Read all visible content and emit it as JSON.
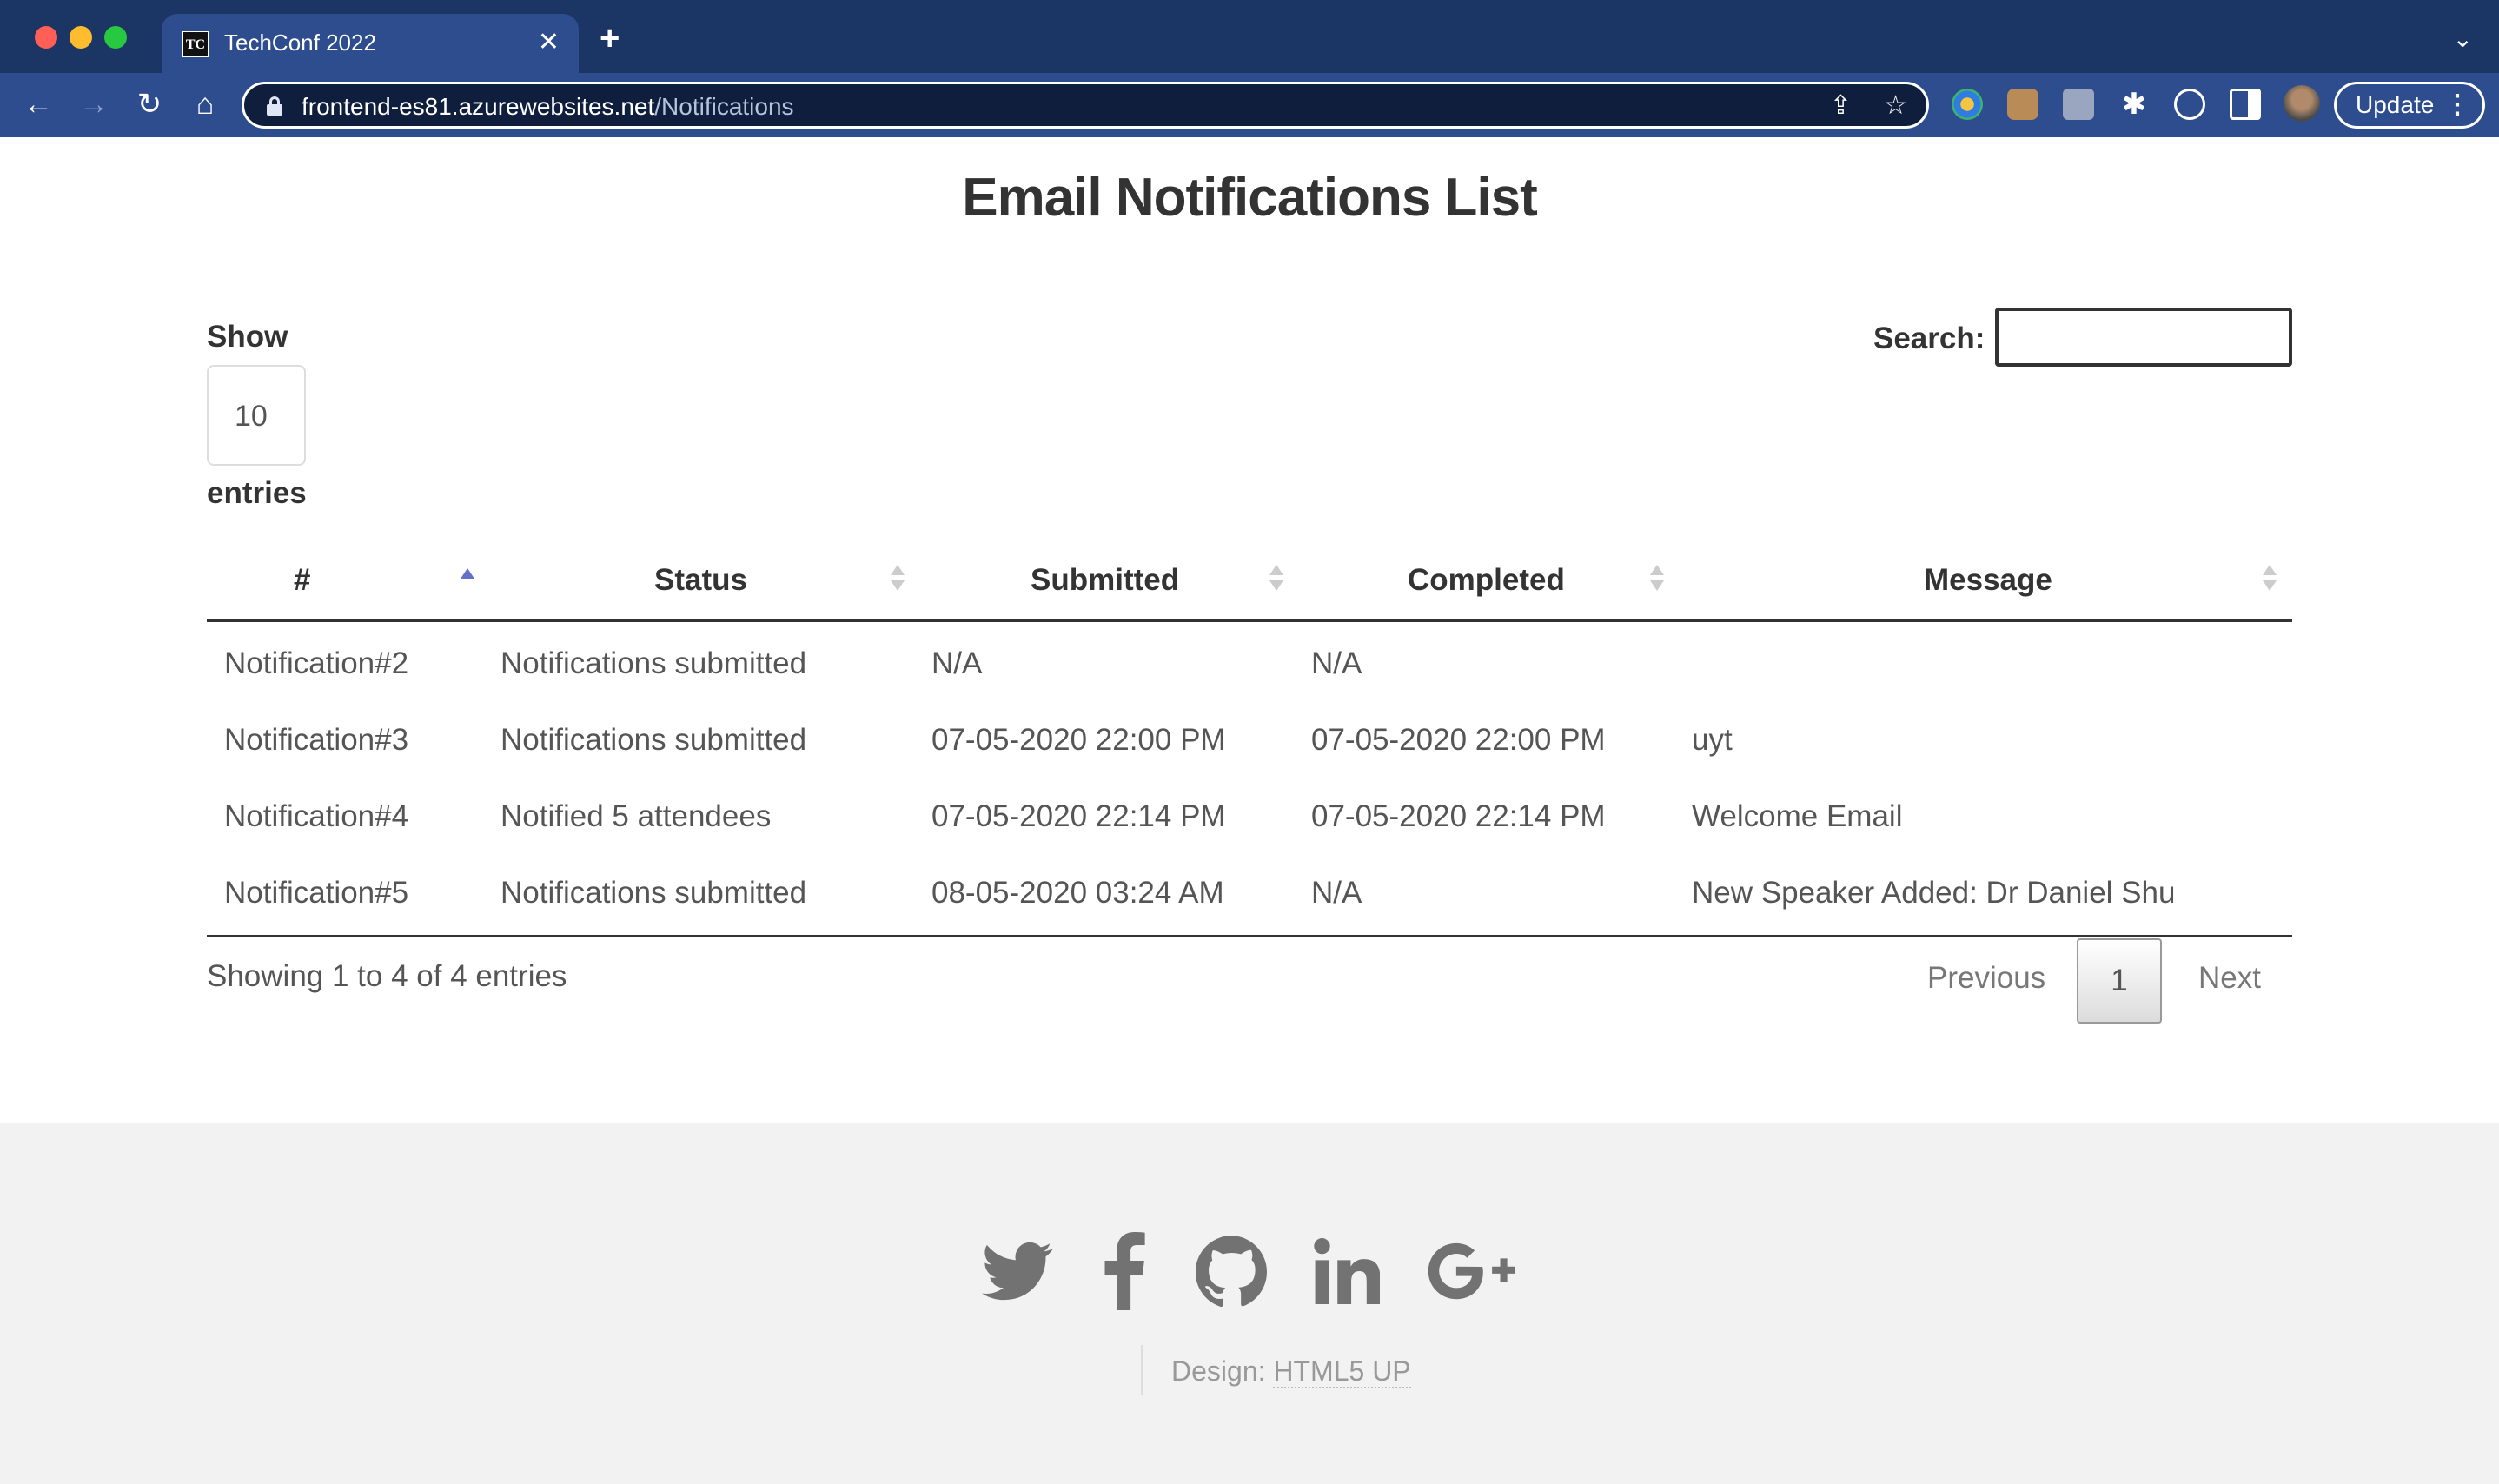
{
  "browser": {
    "tab_title": "TechConf 2022",
    "tab_favicon_text": "TC",
    "url_host": "frontend-es81.azurewebsites.net",
    "url_path": "/Notifications",
    "update_label": "Update"
  },
  "page": {
    "title": "Email Notifications List",
    "show_label": "Show",
    "entries_value": "10",
    "entries_label": "entries",
    "search_label": "Search:",
    "search_value": ""
  },
  "table": {
    "columns": [
      "#",
      "Status",
      "Submitted",
      "Completed",
      "Message"
    ],
    "rows": [
      [
        "Notification#2",
        "Notifications submitted",
        "N/A",
        "N/A",
        ""
      ],
      [
        "Notification#3",
        "Notifications submitted",
        "07-05-2020 22:00 PM",
        "07-05-2020 22:00 PM",
        "uyt"
      ],
      [
        "Notification#4",
        "Notified 5 attendees",
        "07-05-2020 22:14 PM",
        "07-05-2020 22:14 PM",
        "Welcome Email"
      ],
      [
        "Notification#5",
        "Notifications submitted",
        "08-05-2020 03:24 AM",
        "N/A",
        "New Speaker Added: Dr Daniel Shu"
      ]
    ],
    "sorted_column": "#",
    "sort_direction": "ascending"
  },
  "pagination": {
    "info": "Showing 1 to 4 of 4 entries",
    "previous_label": "Previous",
    "current_page": "1",
    "next_label": "Next"
  },
  "footer": {
    "social_icons": [
      "twitter-icon",
      "facebook-icon",
      "github-icon",
      "linkedin-icon",
      "google-plus-icon"
    ],
    "credit_prefix": "Design:",
    "credit_link": "HTML5 UP"
  },
  "colors": {
    "browser_frame": "#1f3a6b",
    "active_sort_arrow": "#6670c9",
    "footer_background": "#f2f2f2"
  }
}
